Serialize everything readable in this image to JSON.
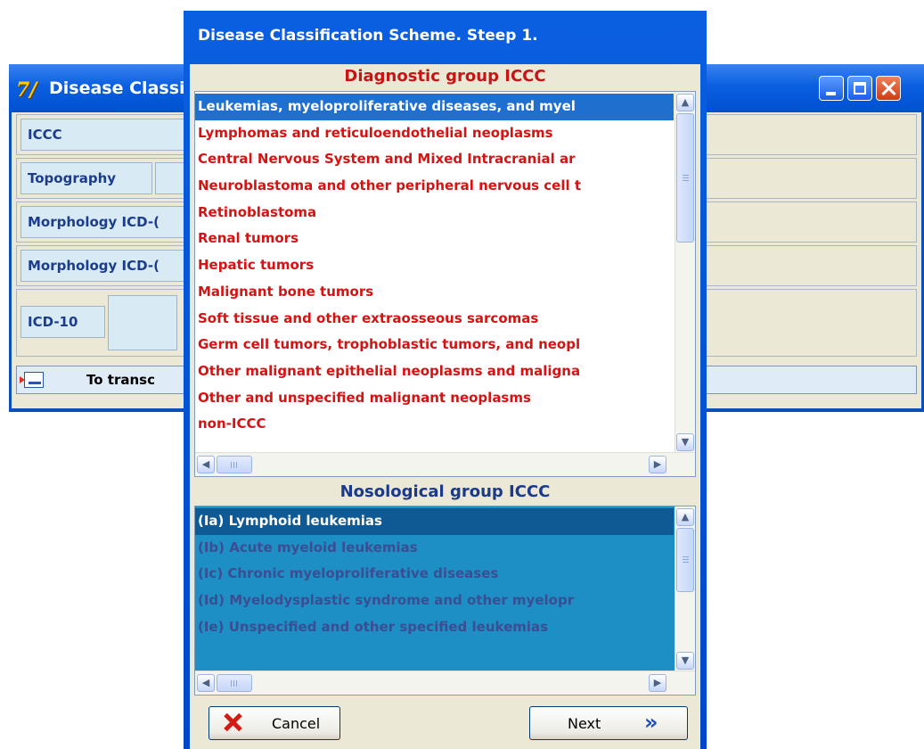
{
  "background_window": {
    "app_icon": "7/",
    "title": "Disease Classi",
    "controls": {
      "minimize": "minimize-icon",
      "maximize": "maximize-icon",
      "close": "close-icon"
    },
    "rows": [
      {
        "label": "ICCC"
      },
      {
        "label": "Topography"
      },
      {
        "label": "Morphology ICD-("
      },
      {
        "label": "Morphology ICD-("
      },
      {
        "label": "ICD-10"
      }
    ],
    "transfer_button": "To transc"
  },
  "dialog": {
    "title": "Disease Classification Scheme. Steep 1.",
    "diagnostic_group": {
      "header": "Diagnostic group ICCC",
      "items": [
        "Leukemias, myeloproliferative diseases, and myel",
        "Lymphomas and reticuloendothelial neoplasms",
        "Central Nervous System and Mixed Intracranial ar",
        "Neuroblastoma and other peripheral nervous cell t",
        "Retinoblastoma",
        "Renal tumors",
        "Hepatic tumors",
        "Malignant bone tumors",
        "Soft tissue and other extraosseous sarcomas",
        "Germ cell tumors, trophoblastic tumors, and neopl",
        "Other malignant epithelial neoplasms and maligna",
        "Other and unspecified malignant neoplasms",
        "non-ICCC"
      ],
      "selected_item": "Leukemias, myeloproliferative diseases, and myel"
    },
    "nosological_group": {
      "header": "Nosological group ICCC",
      "items": [
        "(Ia) Lymphoid leukemias",
        "(Ib) Acute myeloid leukemias",
        "(Ic) Chronic myeloproliferative diseases",
        "(Id) Myelodysplastic syndrome and other myelopr",
        "(Ie) Unspecified and other specified leukemias"
      ],
      "selected_item": "(Ia) Lymphoid leukemias"
    },
    "buttons": {
      "cancel": "Cancel",
      "next": "Next",
      "next_glyph": "»"
    }
  },
  "colors": {
    "titlebar_blue": "#0a5fe0",
    "window_face": "#ebe8d6",
    "diagnostic_text": "#d41414",
    "selection_blue": "#1f6fcf",
    "nosological_list_bg": "#1d8fc4",
    "nosological_text": "#3b4d93"
  }
}
